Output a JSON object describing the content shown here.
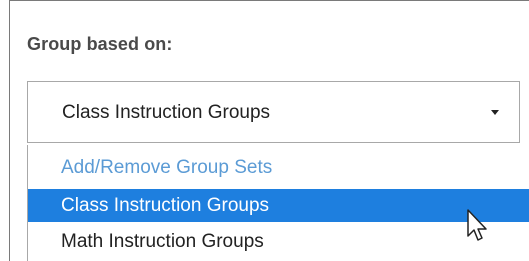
{
  "group_label": "Group based on:",
  "select": {
    "selected_value": "Class Instruction Groups"
  },
  "dropdown": {
    "options": [
      {
        "label": "Add/Remove Group Sets",
        "state": "action"
      },
      {
        "label": "Class Instruction Groups",
        "state": "selected"
      },
      {
        "label": "Math Instruction Groups",
        "state": "normal"
      }
    ]
  },
  "icons": {
    "caret": "chevron-down-icon",
    "cursor": "mouse-pointer-icon"
  },
  "colors": {
    "highlight": "#1e7fdf",
    "link": "#5b9bd5"
  }
}
